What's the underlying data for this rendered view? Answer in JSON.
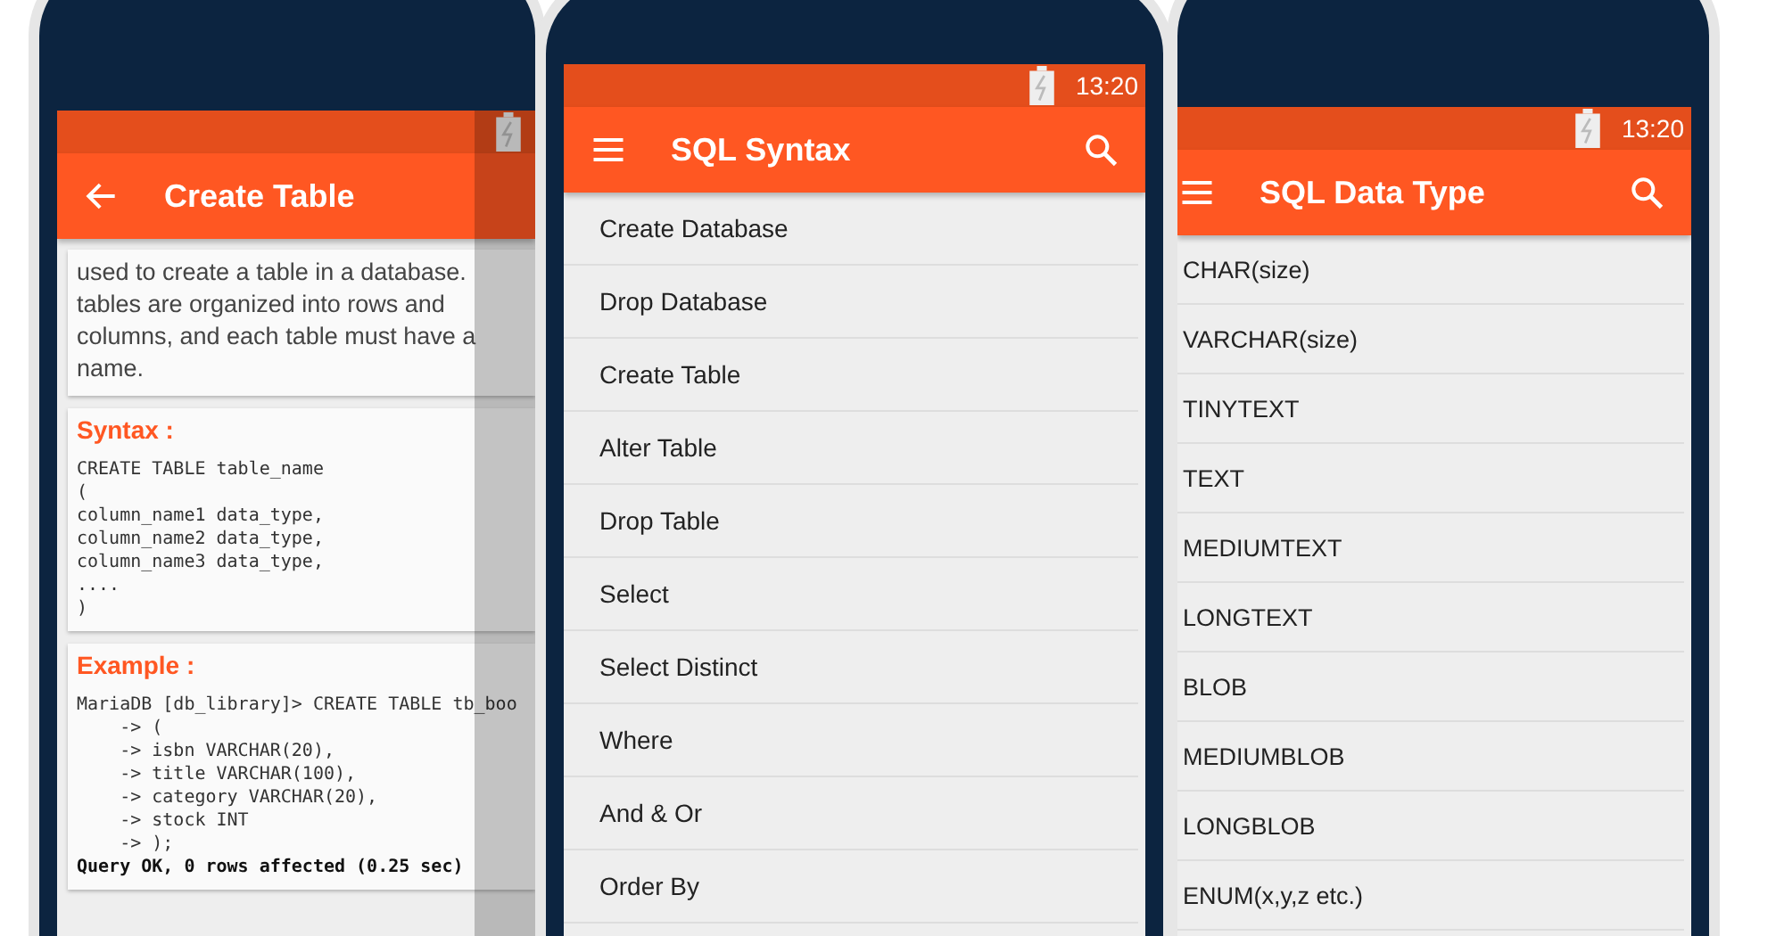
{
  "phones": [
    {
      "kind": "detail",
      "app_bar": {
        "kind": "back",
        "title": "Create Table",
        "search": false
      },
      "description": "used to create a table in a database. tables are organized into rows and columns, and each table must have a name.",
      "sections": [
        {
          "heading": "Syntax :",
          "lines": [
            "CREATE TABLE table_name",
            "(",
            "column_name1 data_type,",
            "column_name2 data_type,",
            "column_name3 data_type,",
            "....",
            ")"
          ]
        },
        {
          "heading": "Example :",
          "lines": [
            "MariaDB [db_library]> CREATE TABLE tb_boo",
            "    -> (",
            "    -> isbn VARCHAR(20),",
            "    -> title VARCHAR(100),",
            "    -> category VARCHAR(20),",
            "    -> stock INT",
            "    -> );"
          ],
          "result": "Query OK, 0 rows affected (0.25 sec)"
        }
      ]
    },
    {
      "kind": "list",
      "status_time": "13:20",
      "app_bar": {
        "kind": "menu",
        "title": "SQL Syntax",
        "search": true
      },
      "items": [
        "Create Database",
        "Drop Database",
        "Create Table",
        "Alter Table",
        "Drop Table",
        "Select",
        "Select Distinct",
        "Where",
        "And & Or",
        "Order By"
      ]
    },
    {
      "kind": "list",
      "status_time": "13:20",
      "app_bar": {
        "kind": "menu",
        "title": "SQL Data Type",
        "search": true
      },
      "items": [
        "CHAR(size)",
        "VARCHAR(size)",
        "TINYTEXT",
        "TEXT",
        "MEDIUMTEXT",
        "LONGTEXT",
        "BLOB",
        "MEDIUMBLOB",
        "LONGBLOB",
        "ENUM(x,y,z etc.)"
      ]
    }
  ]
}
